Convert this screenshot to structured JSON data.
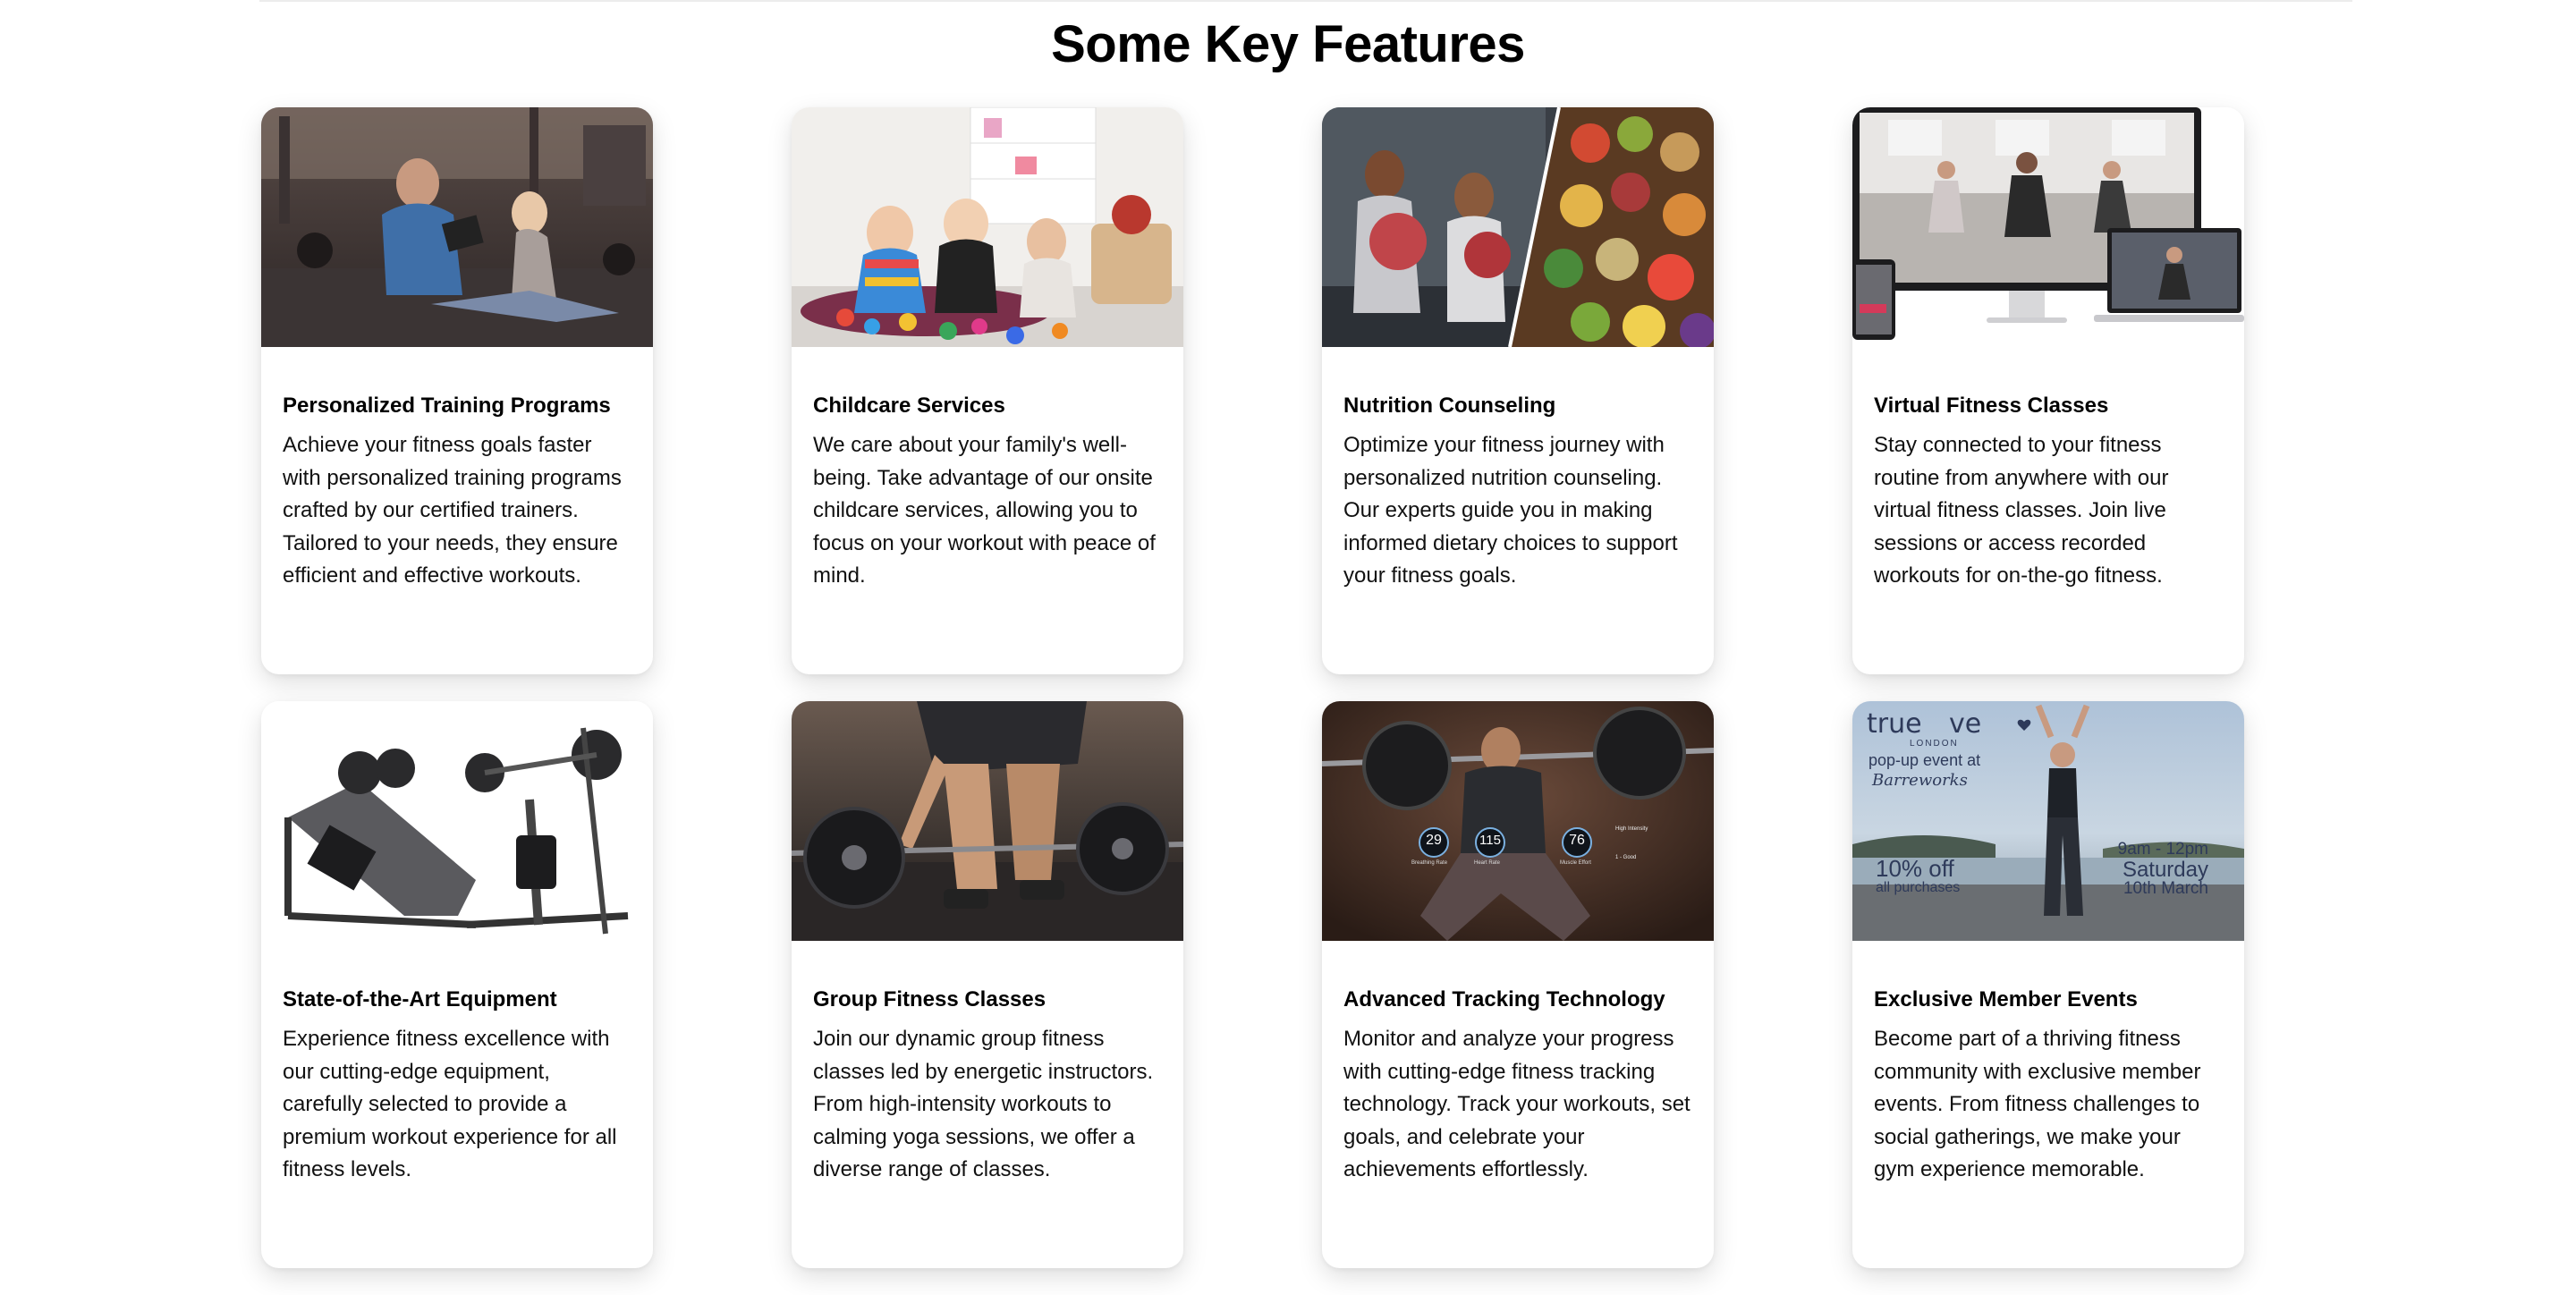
{
  "section": {
    "title": "Some Key Features"
  },
  "features": [
    {
      "title": "Personalized Training Programs",
      "description": "Achieve your fitness goals faster with personalized training programs crafted by our certified trainers. Tailored to your needs, they ensure efficient and effective workouts.",
      "image": "trainer-assisting-client-photo"
    },
    {
      "title": "Childcare Services",
      "description": "We care about your family's well-being. Take advantage of our onsite childcare services, allowing you to focus on your workout with peace of mind.",
      "image": "children-playing-photo"
    },
    {
      "title": "Nutrition Counseling",
      "description": "Optimize your fitness journey with personalized nutrition counseling. Our experts guide you in making informed dietary choices to support your fitness goals.",
      "image": "workout-and-healthy-food-photo"
    },
    {
      "title": "Virtual Fitness Classes",
      "description": "Stay connected to your fitness routine from anywhere with our virtual fitness classes. Join live sessions or access recorded workouts for on-the-go fitness.",
      "image": "virtual-class-devices-photo"
    },
    {
      "title": "State-of-the-Art Equipment",
      "description": "Experience fitness excellence with our cutting-edge equipment, carefully selected to provide a premium workout experience for all fitness levels.",
      "image": "gym-machines-photo"
    },
    {
      "title": "Group Fitness Classes",
      "description": "Join our dynamic group fitness classes led by energetic instructors. From high-intensity workouts to calming yoga sessions, we offer a diverse range of classes.",
      "image": "deadlift-barbell-photo"
    },
    {
      "title": "Advanced Tracking Technology",
      "description": "Monitor and analyze your progress with cutting-edge fitness tracking technology. Track your workouts, set goals, and celebrate your achievements effortlessly.",
      "image": "squat-with-metrics-photo",
      "overlay_metrics": [
        {
          "value": "29",
          "label": "Breathing Rate"
        },
        {
          "value": "115",
          "label": "Heart Rate"
        },
        {
          "value": "76",
          "label": "Muscle Effort"
        }
      ],
      "overlay_tags": [
        "High Intensity",
        "1 - Good"
      ]
    },
    {
      "title": "Exclusive Member Events",
      "description": "Become part of a thriving fitness community with exclusive member events. From fitness challenges to social gatherings, we make your gym experience memorable.",
      "image": "event-poster-photo",
      "poster": {
        "brand_left": "true",
        "brand_right": "ve",
        "brand_sub": "LONDON",
        "line1": "pop-up event at",
        "venue": "Barreworks",
        "discount": "10% off",
        "discount_sub": "all purchases",
        "time": "9am - 12pm",
        "day": "Saturday",
        "date": "10th March"
      }
    }
  ]
}
